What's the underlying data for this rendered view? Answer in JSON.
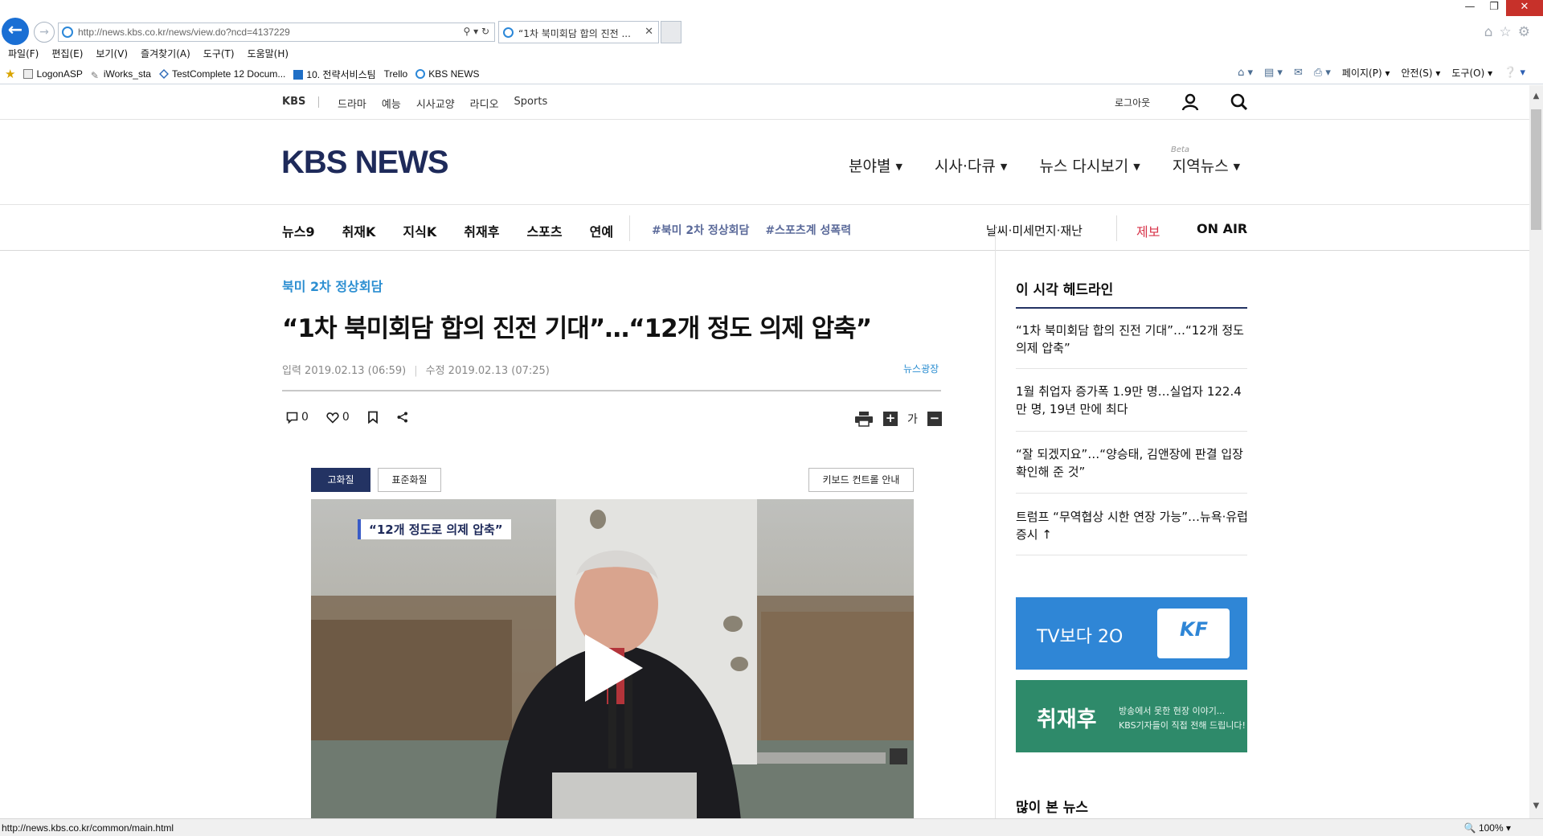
{
  "browser": {
    "url": "http://news.kbs.co.kr/news/view.do?ncd=4137229",
    "tab_title": "“1차 북미회담 합의 진전 ...",
    "menu": [
      "파일(F)",
      "편집(E)",
      "보기(V)",
      "즐겨찾기(A)",
      "도구(T)",
      "도움말(H)"
    ],
    "favorites": [
      "LogonASP",
      "iWorks_sta",
      "TestComplete 12 Docum...",
      "10. 전략서비스팀",
      "Trello",
      "KBS NEWS"
    ],
    "commands": [
      "페이지(P)",
      "안전(S)",
      "도구(O)"
    ],
    "status_url": "http://news.kbs.co.kr/common/main.html",
    "zoom": "100%"
  },
  "gnb": {
    "brand": "KBS",
    "links": [
      "드라마",
      "예능",
      "시사교양",
      "라디오",
      "Sports"
    ],
    "logout": "로그아웃"
  },
  "header": {
    "logo": "KBS NEWS",
    "menu": [
      "분야별",
      "시사·다큐",
      "뉴스 다시보기",
      "지역뉴스"
    ],
    "beta": "Beta"
  },
  "subnav": {
    "items": [
      "뉴스9",
      "취재K",
      "지식K",
      "취재후",
      "스포츠",
      "연예"
    ],
    "tags": [
      "#북미 2차 정상회담",
      "#스포츠계 성폭력"
    ],
    "weather": "날씨·미세먼지·재난",
    "jebo": "제보",
    "onair": "ON AIR"
  },
  "article": {
    "category": "북미 2차 정상회담",
    "headline": "“1차 북미회담 합의 진전 기대”…“12개 정도 의제 압축”",
    "input": "입력 2019.02.13 (06:59)",
    "modified": "수정 2019.02.13 (07:25)",
    "source": "뉴스광장",
    "comments": "0",
    "likes": "0",
    "font_label": "가",
    "hq_label": "고화질",
    "sq_label": "표준화질",
    "keyboard_label": "키보드 컨트롤 안내",
    "video_caption": "“12개 정도로 의제 압축”"
  },
  "sidebar": {
    "title": "이 시각 헤드라인",
    "headlines": [
      "“1차 북미회담 합의 진전 기대”…“12개 정도 의제 압축”",
      "1월 취업자 증가폭 1.9만 명…실업자 122.4만 명, 19년 만에 최다",
      "“잘 되겠지요”…“양승태, 김앤장에 판결 입장 확인해 준 것”",
      "트럼프 “무역협상 시한 연장 가능”…뉴욕·유럽 증시 ↑"
    ],
    "banner1_text": "TV보다 2O",
    "banner1_badge": "KF",
    "banner2_title": "취재후",
    "banner2_line1": "방송에서 못한 현장 이야기...",
    "banner2_line2": "KBS기자들이 직접 전해 드립니다!",
    "most_viewed": "많이 본 뉴스"
  },
  "colors": {
    "brand_navy": "#1e2a5a",
    "accent_blue": "#2b8ed1",
    "jebo_red": "#d8344a",
    "banner1_bg": "#2f86d6",
    "banner2_bg": "#2e8a6a"
  }
}
